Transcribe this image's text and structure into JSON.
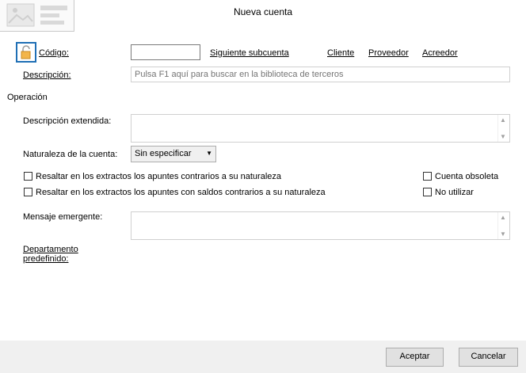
{
  "window": {
    "title": "Nueva cuenta"
  },
  "fields": {
    "codigo_label": "Código:",
    "descripcion_label": "Descripción:",
    "descripcion_placeholder": "Pulsa F1 aquí para buscar en la biblioteca de terceros",
    "descripcion_extendida_label": "Descripción extendida:",
    "naturaleza_label": "Naturaleza de la cuenta:",
    "naturaleza_value": "Sin especificar",
    "mensaje_label": "Mensaje emergente:",
    "departamento_label_line1": "Departamento",
    "departamento_label_line2": "predefinido:"
  },
  "links": {
    "siguiente_subcuenta": "Siguiente subcuenta",
    "cliente": "Cliente",
    "proveedor": "Proveedor",
    "acreedor": "Acreedor"
  },
  "sections": {
    "operacion": "Operación"
  },
  "checkboxes": {
    "resaltar_contrarios": "Resaltar en los extractos los apuntes contrarios a su naturaleza",
    "resaltar_saldos": "Resaltar en los extractos los apuntes con saldos contrarios a su naturaleza",
    "cuenta_obsoleta": "Cuenta obsoleta",
    "no_utilizar": "No utilizar"
  },
  "buttons": {
    "aceptar": "Aceptar",
    "cancelar": "Cancelar"
  },
  "colors": {
    "lock_border": "#1f6fb5",
    "lock_body": "#f3b54a"
  }
}
